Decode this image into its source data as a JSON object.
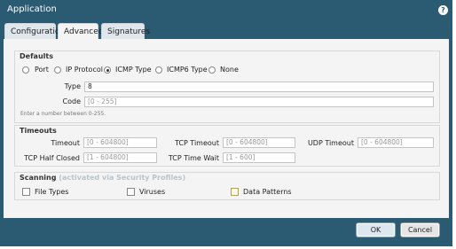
{
  "dialog": {
    "title": "Application",
    "help_icon": "question-icon"
  },
  "tabs": [
    {
      "label": "Configuration"
    },
    {
      "label": "Advanced",
      "active": true
    },
    {
      "label": "Signatures"
    }
  ],
  "defaults": {
    "title": "Defaults",
    "options": [
      "Port",
      "IP Protocol",
      "ICMP Type",
      "ICMP6 Type",
      "None"
    ],
    "selected": "ICMP Type",
    "type_label": "Type",
    "type_value": "8",
    "code_label": "Code",
    "code_placeholder": "[0 - 255]",
    "hint": "Enter a number between 0-255."
  },
  "timeouts": {
    "title": "Timeouts",
    "timeout_label": "Timeout",
    "timeout_placeholder": "[0 - 604800]",
    "tcp_timeout_label": "TCP Timeout",
    "tcp_timeout_placeholder": "[0 - 604800]",
    "udp_timeout_label": "UDP Timeout",
    "udp_timeout_placeholder": "[0 - 604800]",
    "tcp_half_closed_label": "TCP Half Closed",
    "tcp_half_closed_placeholder": "[1 - 604800]",
    "tcp_time_wait_label": "TCP Time Wait",
    "tcp_time_wait_placeholder": "[1 - 600]"
  },
  "scanning": {
    "title": "Scanning",
    "subtitle": "(activated via Security Profiles)",
    "items": [
      "File Types",
      "Viruses",
      "Data Patterns"
    ]
  },
  "buttons": {
    "ok": "OK",
    "cancel": "Cancel"
  },
  "colors": {
    "frame": "#2b5a73",
    "panel": "#f4f4f4"
  }
}
